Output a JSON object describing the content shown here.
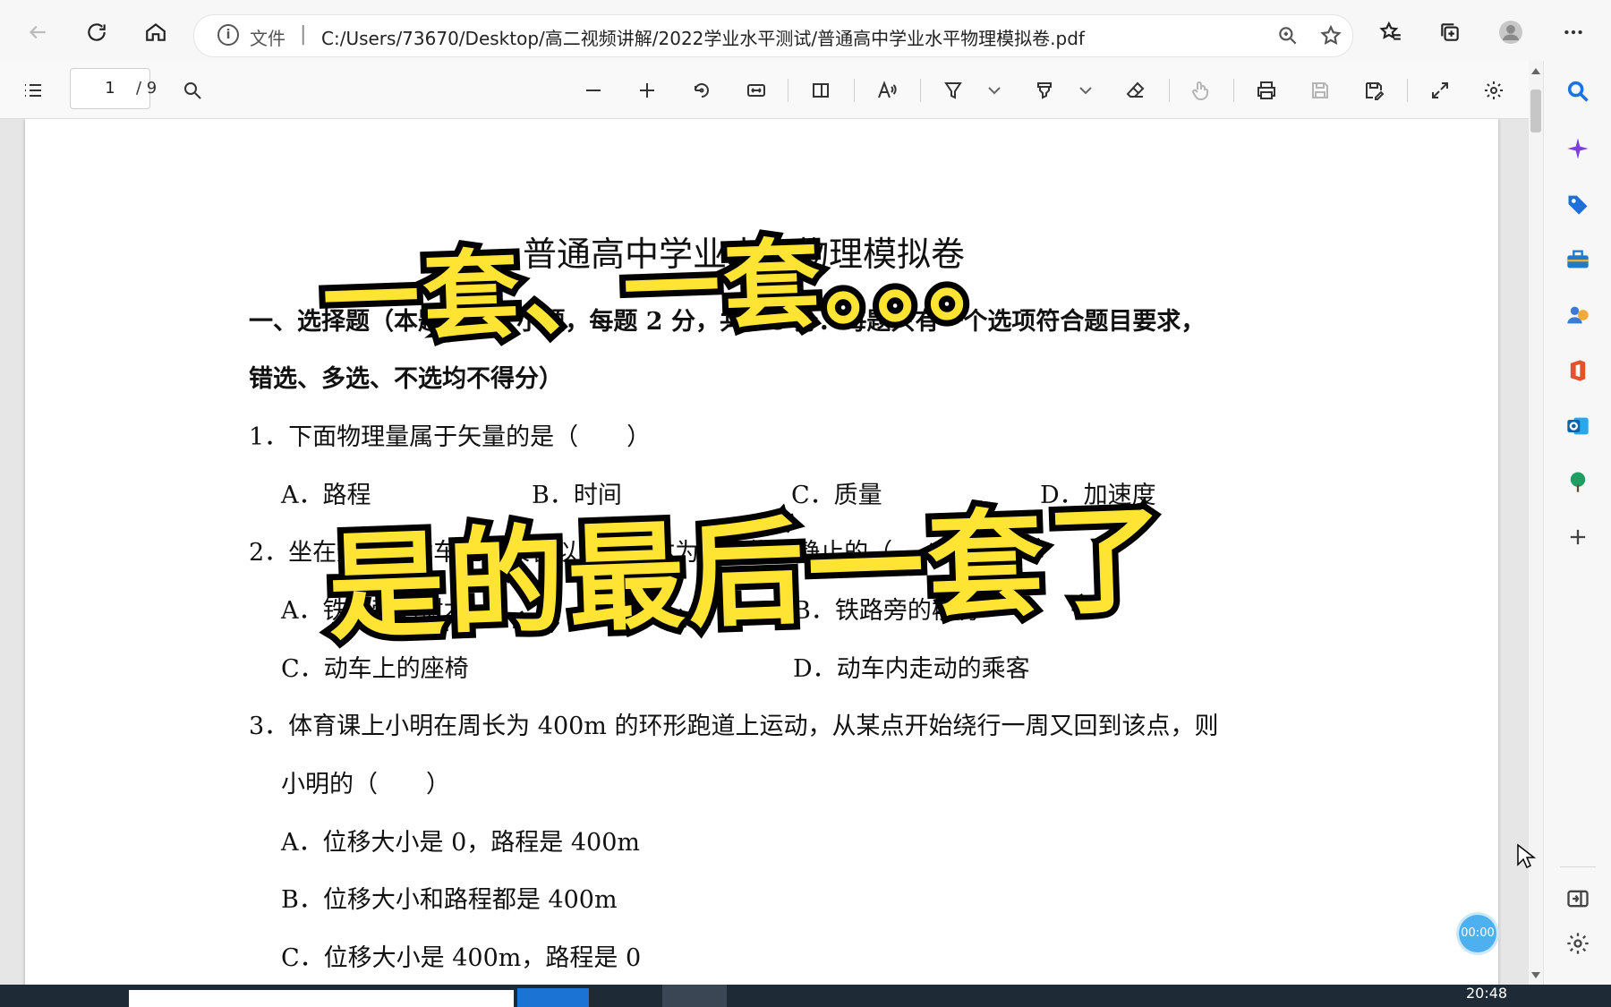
{
  "browser": {
    "address_label": "文件",
    "url": "C:/Users/73670/Desktop/高二视频讲解/2022学业水平测试/普通高中学业水平物理模拟卷.pdf"
  },
  "pdf_toolbar": {
    "page_current": "1",
    "page_total": "/ 9"
  },
  "document": {
    "title": "普通高中学业水平物理模拟卷",
    "lines": [
      "一、选择题（本题共 24 小题，每题 2 分，共 48 分．每题只有一个选项符合题目要求，",
      "错选、多选、不选均不得分）",
      "1．下面物理量属于矢量的是（　　）",
      "A．路程",
      "B．时间",
      "C．质量",
      "D．加速度",
      "2．坐在运动的动车上的乘客以哪个物体为参照物是静止的（　　）",
      "A．铁路旁的树木",
      "B．铁路旁的楼房",
      "C．动车上的座椅",
      "D．动车内走动的乘客",
      "3．体育课上小明在周长为 400m 的环形跑道上运动，从某点开始绕行一周又回到该点，则",
      "小明的（　　）",
      "A．位移大小是 0，路程是 400m",
      "B．位移大小和路程都是 400m",
      "C．位移大小是 400m，路程是 0"
    ]
  },
  "overlay_caption": {
    "line1": "一套、一套。。。",
    "line2": "是的最后一套了"
  },
  "timer": "00:00",
  "taskbar": {
    "time": "20:48"
  },
  "icons": [
    "back-icon",
    "refresh-icon",
    "home-icon",
    "info-icon",
    "zoom-icon",
    "add-favorite-icon",
    "favorites-icon",
    "collections-icon",
    "profile-icon",
    "more-icon",
    "toc-icon",
    "search-icon",
    "zoom-out-icon",
    "zoom-in-icon",
    "rotate-icon",
    "fit-width-icon",
    "page-view-icon",
    "read-aloud-icon",
    "draw-icon",
    "highlight-icon",
    "erase-icon",
    "touch-icon",
    "print-icon",
    "save-icon",
    "save-as-icon",
    "fullscreen-icon",
    "settings-icon"
  ]
}
